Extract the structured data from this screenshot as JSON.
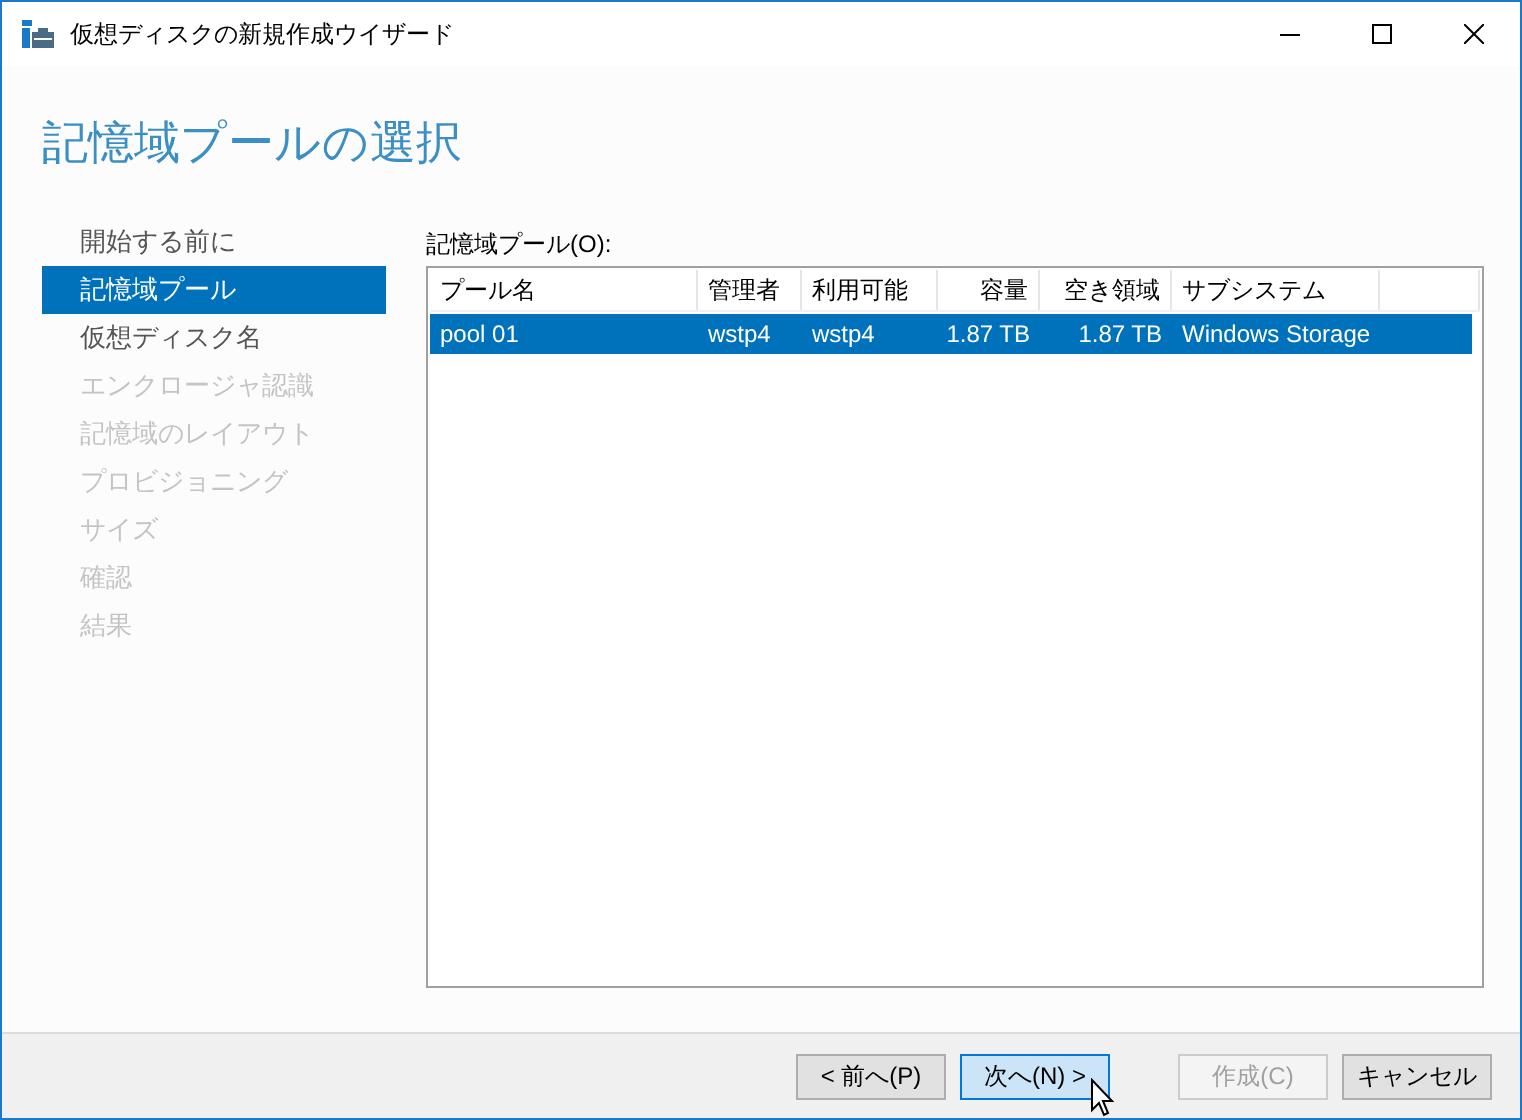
{
  "window": {
    "title": "仮想ディスクの新規作成ウイザード"
  },
  "heading": "記憶域プールの選択",
  "steps": [
    {
      "label": "開始する前に",
      "selected": false,
      "disabled": false
    },
    {
      "label": "記憶域プール",
      "selected": true,
      "disabled": false
    },
    {
      "label": "仮想ディスク名",
      "selected": false,
      "disabled": false
    },
    {
      "label": "エンクロージャ認識",
      "selected": false,
      "disabled": true
    },
    {
      "label": "記憶域のレイアウト",
      "selected": false,
      "disabled": true
    },
    {
      "label": "プロビジョニング",
      "selected": false,
      "disabled": true
    },
    {
      "label": "サイズ",
      "selected": false,
      "disabled": true
    },
    {
      "label": "確認",
      "selected": false,
      "disabled": true
    },
    {
      "label": "結果",
      "selected": false,
      "disabled": true
    }
  ],
  "pool_list": {
    "label": "記憶域プール(O):",
    "columns": [
      {
        "label": "プール名",
        "kind": "text"
      },
      {
        "label": "管理者",
        "kind": "text"
      },
      {
        "label": "利用可能",
        "kind": "text"
      },
      {
        "label": "容量",
        "kind": "number"
      },
      {
        "label": "空き領域",
        "kind": "number"
      },
      {
        "label": "サブシステム",
        "kind": "text"
      }
    ],
    "rows": [
      {
        "cells": [
          "pool 01",
          "wstp4",
          "wstp4",
          "1.87 TB",
          "1.87 TB",
          "Windows Storage"
        ],
        "selected": true
      }
    ]
  },
  "buttons": [
    {
      "label": "< 前へ(P)",
      "focused": false,
      "disabled": false
    },
    {
      "label": "次へ(N) >",
      "focused": true,
      "disabled": false
    },
    {
      "label": "作成(C)",
      "focused": false,
      "disabled": true
    },
    {
      "label": "キャンセル",
      "focused": false,
      "disabled": false
    }
  ]
}
